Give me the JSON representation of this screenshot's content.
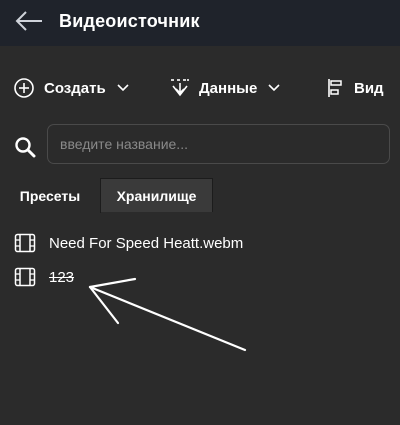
{
  "header": {
    "title": "Видеоисточник",
    "back_icon": "arrow-left-icon"
  },
  "toolbar": {
    "create_label": "Создать",
    "data_label": "Данные",
    "view_label": "Вид"
  },
  "search": {
    "placeholder": "введите название..."
  },
  "tabs": [
    {
      "label": "Пресеты",
      "active": true
    },
    {
      "label": "Хранилище",
      "active": false
    }
  ],
  "items": [
    {
      "name": "Need For Speed Heatt.webm",
      "icon": "film-icon"
    },
    {
      "name": "123",
      "icon": "film-icon"
    }
  ],
  "colors": {
    "header_bg": "#1f232b",
    "panel_bg": "#2b2b2b",
    "inactive_tab_bg": "#3a3a3a",
    "text": "#ffffff",
    "placeholder": "#8a8a8a"
  }
}
